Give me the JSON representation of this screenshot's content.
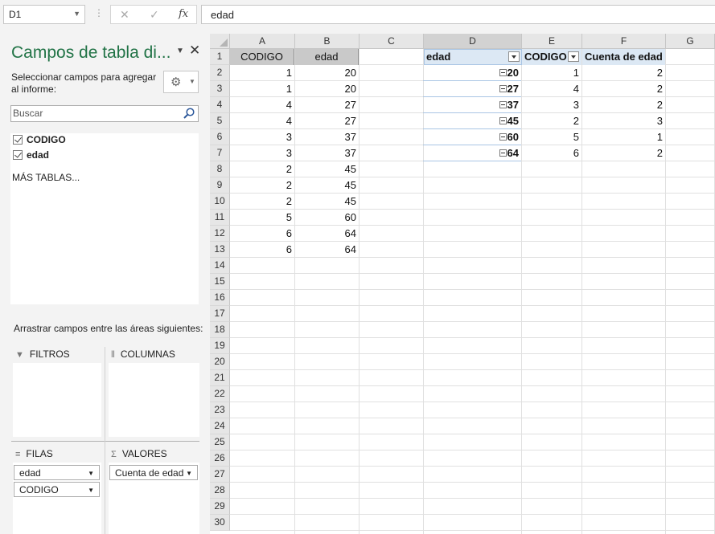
{
  "formula_bar": {
    "name_box": "D1",
    "fx_label": "fx",
    "cancel_glyph": "✕",
    "enter_glyph": "✓",
    "content": "edad"
  },
  "pane": {
    "title": "Campos de tabla di...",
    "subtitle": "Seleccionar campos para agregar al informe:",
    "search_placeholder": "Buscar",
    "fields": [
      "CODIGO",
      "edad"
    ],
    "more_tables": "MÁS TABLAS...",
    "drag_instruction": "Arrastrar campos entre las áreas siguientes:",
    "areas": {
      "filters": "FILTROS",
      "columns": "COLUMNAS",
      "rows": "FILAS",
      "values": "VALORES"
    },
    "rows_items": [
      "edad",
      "CODIGO"
    ],
    "values_items": [
      "Cuenta de edad"
    ]
  },
  "sheet": {
    "columns": [
      "A",
      "B",
      "C",
      "D",
      "E",
      "F",
      "G"
    ],
    "rows": [
      "1",
      "2",
      "3",
      "4",
      "5",
      "6",
      "7",
      "8",
      "9",
      "10",
      "11",
      "12",
      "13",
      "14",
      "15",
      "16",
      "17",
      "18",
      "19",
      "20",
      "21",
      "22",
      "23",
      "24",
      "25",
      "26",
      "27",
      "28",
      "29",
      "30"
    ],
    "table_headers": [
      "CODIGO",
      "edad"
    ],
    "table_rows": [
      [
        "1",
        "20"
      ],
      [
        "1",
        "20"
      ],
      [
        "4",
        "27"
      ],
      [
        "4",
        "27"
      ],
      [
        "3",
        "37"
      ],
      [
        "3",
        "37"
      ],
      [
        "2",
        "45"
      ],
      [
        "2",
        "45"
      ],
      [
        "2",
        "45"
      ],
      [
        "5",
        "60"
      ],
      [
        "6",
        "64"
      ],
      [
        "6",
        "64"
      ]
    ],
    "pivot_headers": [
      "edad",
      "CODIGO",
      "Cuenta de edad"
    ],
    "pivot_rows": [
      [
        "20",
        "1",
        "2"
      ],
      [
        "27",
        "4",
        "2"
      ],
      [
        "37",
        "3",
        "2"
      ],
      [
        "45",
        "2",
        "3"
      ],
      [
        "60",
        "5",
        "1"
      ],
      [
        "64",
        "6",
        "2"
      ]
    ]
  },
  "colors": {
    "accent": "#217346",
    "pivot_header": "#dce8f4",
    "table_header": "#c9c9c9"
  }
}
